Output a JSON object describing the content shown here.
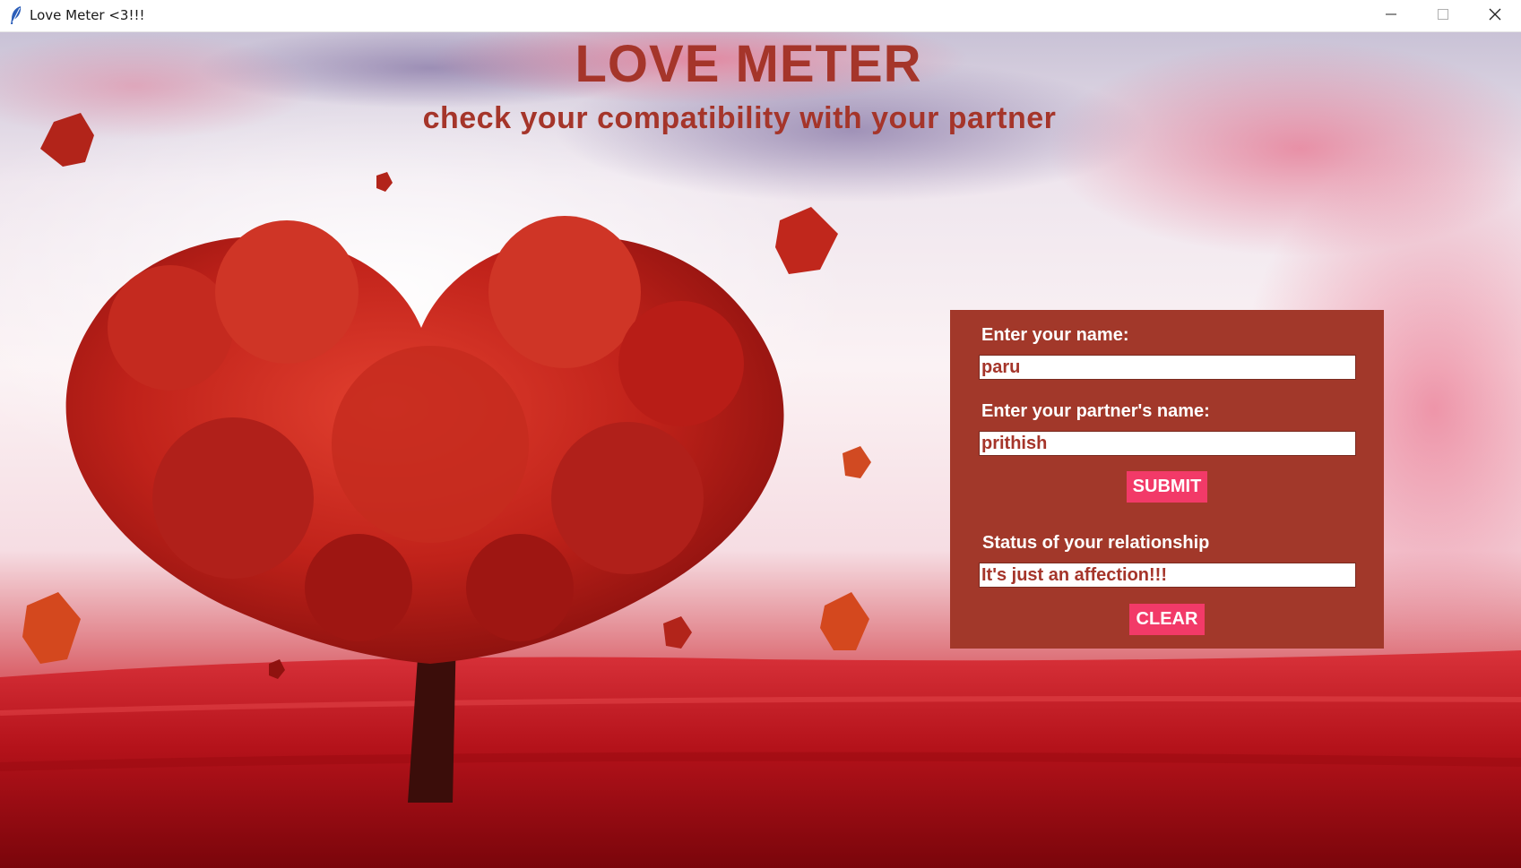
{
  "window": {
    "title": "Love Meter <3!!!",
    "icon": "feather-icon",
    "controls": [
      "minimize-icon",
      "maximize-icon",
      "close-icon"
    ]
  },
  "header": {
    "title": "LOVE METER",
    "subtitle": "check your compatibility with your partner"
  },
  "form": {
    "name_label": "Enter your name:",
    "name_value": "paru",
    "partner_label": "Enter your partner's name:",
    "partner_value": "prithish",
    "submit_label": "SUBMIT",
    "status_label": "Status of your relationship",
    "status_value": "It's just an affection!!!",
    "clear_label": "CLEAR"
  },
  "colors": {
    "title_text": "#a5352a",
    "panel_bg": "#a2382a",
    "button_bg": "#f23a68",
    "field_text": "#a5352a"
  }
}
